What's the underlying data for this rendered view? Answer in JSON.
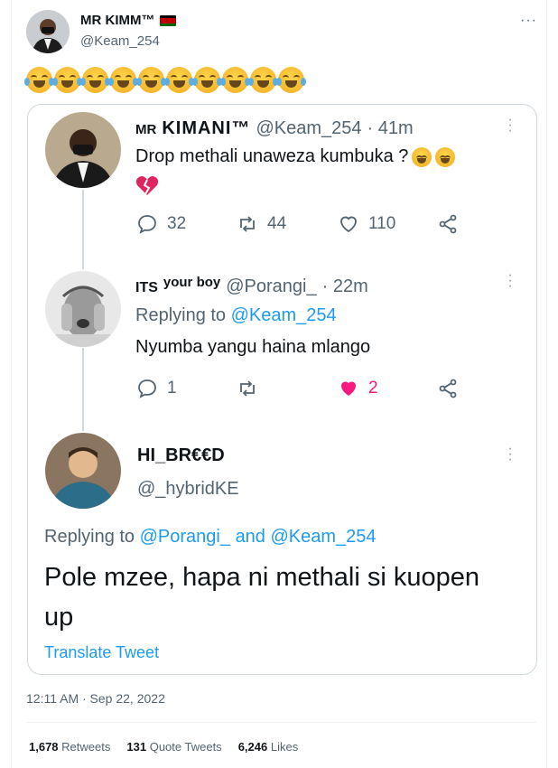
{
  "tweet": {
    "author_name": "MR KIMM™",
    "author_handle": "@Keam_254",
    "more_glyph": "···",
    "emojis": [
      "face-with-tears-of-joy",
      "face-with-tears-of-joy",
      "face-with-tears-of-joy",
      "face-with-tears-of-joy",
      "face-with-tears-of-joy",
      "face-with-tears-of-joy",
      "face-with-tears-of-joy",
      "face-with-tears-of-joy",
      "face-with-tears-of-joy",
      "face-with-tears-of-joy"
    ],
    "timestamp": "12:11 AM · Sep 22, 2022",
    "stats": {
      "retweets_count": "1,678",
      "retweets_label": "Retweets",
      "quotes_count": "131",
      "quotes_label": "Quote Tweets",
      "likes_count": "6,246",
      "likes_label": "Likes"
    }
  },
  "quote": {
    "post1": {
      "name_prefix": "MR",
      "name_main": "KIMANI™",
      "handle": "@Keam_254",
      "time": "· 41m",
      "text": "Drop methali unaweza kumbuka ?",
      "text_emojis": [
        "face-with-tears-of-joy",
        "face-with-tears-of-joy"
      ],
      "broken_heart": "broken-heart",
      "replies": "32",
      "retweets": "44",
      "likes": "110"
    },
    "post2": {
      "name_a": "ITS",
      "name_b": "your boy",
      "handle": "@Porangi_",
      "time": "· 22m",
      "replying_label": "Replying to",
      "replying_to": "@Keam_254",
      "text": "Nyumba yangu haina mlango",
      "replies": "1",
      "likes": "2"
    },
    "post3": {
      "name": "HI_BR€€D",
      "handle": "@_hybridKE",
      "replying_label": "Replying to",
      "replying_to_1": "@Porangi_",
      "and_label": "and",
      "replying_to_2": "@Keam_254",
      "text": "Pole mzee, hapa ni methali si kuopen up",
      "translate": "Translate Tweet"
    }
  },
  "colors": {
    "accent": "#1d9bf0",
    "muted": "#536471",
    "like_pink": "#f91880",
    "flag_black": "#000000",
    "flag_red": "#bb0000",
    "flag_green": "#006600"
  }
}
